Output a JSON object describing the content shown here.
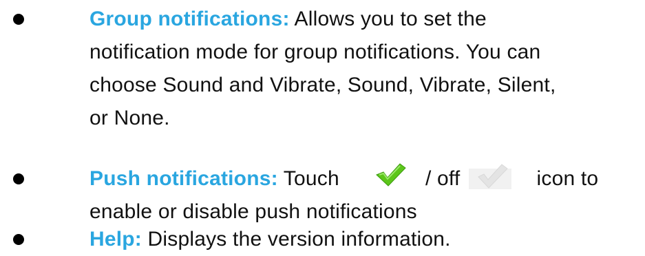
{
  "items": [
    {
      "term": "Group notifications:",
      "line1": " Allows you to set the",
      "line2": "notification mode for group notifications. You can",
      "line3": "choose Sound and Vibrate, Sound, Vibrate, Silent,",
      "line4": "or None."
    },
    {
      "term": "Push notifications:",
      "pre_icon": " Touch",
      "mid_text": "/ off",
      "post_icon": "icon to",
      "line2": "enable or disable push notifications",
      "icons": [
        "checkmark-on-icon",
        "checkmark-off-icon"
      ]
    },
    {
      "term": "Help:",
      "line1": " Displays the version information."
    }
  ],
  "colors": {
    "term": "#2aa6e0",
    "check_on": "#5cc61a",
    "check_off": "#e4e4e4"
  }
}
